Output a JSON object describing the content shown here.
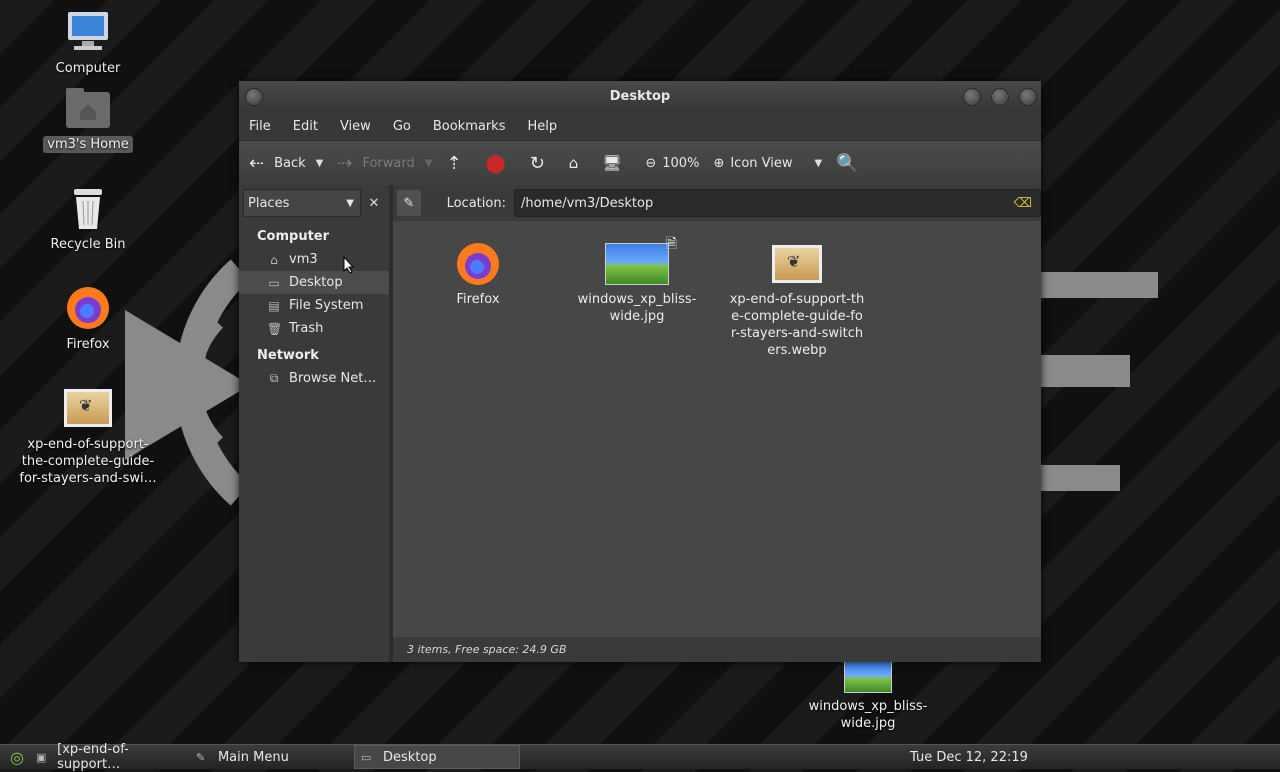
{
  "desktop": {
    "icons": [
      {
        "label": "Computer",
        "icon": "computer-icon"
      },
      {
        "label": "vm3's Home",
        "icon": "home-folder-icon"
      },
      {
        "label": "Recycle Bin",
        "icon": "trash-icon"
      },
      {
        "label": "Firefox",
        "icon": "firefox-icon"
      },
      {
        "label": "xp-end-of-support-the-complete-guide-for-stayers-and-swi…",
        "icon": "image-file-icon"
      },
      {
        "label": "windows_xp_bliss-wide.jpg",
        "icon": "image-file-icon"
      }
    ]
  },
  "window": {
    "title": "Desktop",
    "menu": [
      "File",
      "Edit",
      "View",
      "Go",
      "Bookmarks",
      "Help"
    ],
    "toolbar": {
      "back": "Back",
      "forward": "Forward",
      "zoom": "100%",
      "view_mode": "Icon View"
    },
    "sidebar": {
      "selector": "Places",
      "sections": [
        {
          "title": "Computer",
          "items": [
            {
              "label": "vm3",
              "icon": "home-icon"
            },
            {
              "label": "Desktop",
              "icon": "desktop-folder-icon"
            },
            {
              "label": "File System",
              "icon": "drive-icon"
            },
            {
              "label": "Trash",
              "icon": "trash-icon"
            }
          ]
        },
        {
          "title": "Network",
          "items": [
            {
              "label": "Browse Net…",
              "icon": "network-icon"
            }
          ]
        }
      ]
    },
    "location": {
      "label": "Location:",
      "value": "/home/vm3/Desktop"
    },
    "files": [
      {
        "label": "Firefox",
        "icon": "firefox-icon"
      },
      {
        "label": "windows_xp_bliss-wide.jpg",
        "icon": "image-file-icon"
      },
      {
        "label": "xp-end-of-support-the-complete-guide-for-stayers-and-switchers.webp",
        "icon": "image-file-icon"
      }
    ],
    "status": "3 items, Free space: 24.9 GB"
  },
  "taskbar": {
    "tasks": [
      {
        "label": "[xp-end-of-support…",
        "icon": "image-viewer-icon"
      },
      {
        "label": "Main Menu",
        "icon": "menu-editor-icon"
      },
      {
        "label": "Desktop",
        "icon": "folder-icon"
      }
    ],
    "clock": "Tue Dec 12, 22:19"
  }
}
